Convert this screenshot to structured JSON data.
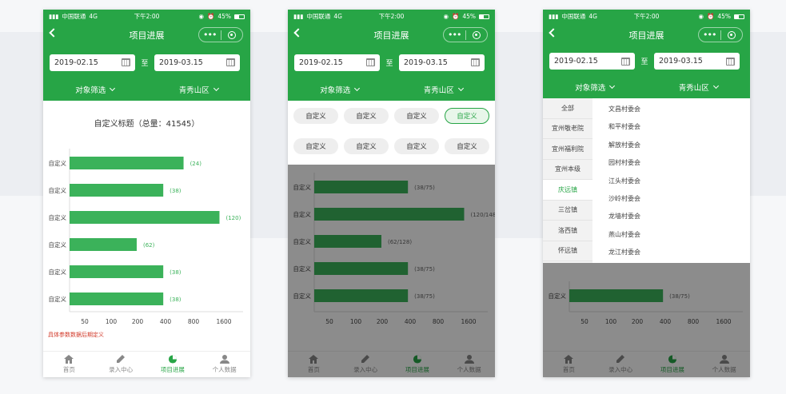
{
  "status": {
    "carrier": "中国联通",
    "network": "4G",
    "time": "下午2:00",
    "battery": "45%"
  },
  "nav": {
    "title": "项目进展",
    "more": "•••"
  },
  "dates": {
    "start": "2019-02.15",
    "sep": "至",
    "end": "2019-03.15"
  },
  "filters": {
    "object": "对象筛选",
    "region": "青秀山区"
  },
  "screen1": {
    "title": "自定义标题（总量：41545）",
    "footnote": "具体参数数据后期定义",
    "chart_data": {
      "type": "bar",
      "orientation": "horizontal",
      "categories": [
        "自定义",
        "自定义",
        "自定义",
        "自定义",
        "自定义",
        "自定义"
      ],
      "values": [
        24,
        38,
        120,
        62,
        38,
        38
      ],
      "value_labels": [
        "(24)",
        "(38)",
        "(120)",
        "(62)",
        "(38)",
        "(38)"
      ],
      "bar_fill": [
        0.73,
        0.6,
        0.96,
        0.43,
        0.6,
        0.6
      ],
      "x_ticks": [
        "50",
        "100",
        "200",
        "400",
        "800",
        "1600"
      ],
      "color": "#3bb25a"
    }
  },
  "screen2": {
    "chips": [
      "自定义",
      "自定义",
      "自定义",
      "自定义",
      "自定义",
      "自定义",
      "自定义",
      "自定义"
    ],
    "selected_chip": 3,
    "chart_data": {
      "type": "bar",
      "orientation": "horizontal",
      "categories": [
        "自定义",
        "自定义",
        "自定义",
        "自定义",
        "自定义"
      ],
      "value_labels": [
        "(38/75)",
        "(120/148)",
        "(62/128)",
        "(38/75)",
        "(38/75)"
      ],
      "bar_fill": [
        0.6,
        0.96,
        0.43,
        0.6,
        0.6
      ],
      "x_ticks": [
        "50",
        "100",
        "200",
        "400",
        "800",
        "1600"
      ]
    }
  },
  "screen3": {
    "left_items": [
      "全部",
      "宜州敬老院",
      "宜州福利院",
      "宜州本级",
      "庆远镇",
      "三岔镇",
      "洛西镇",
      "怀远镇"
    ],
    "selected_left": 4,
    "right_items": [
      "文昌村委会",
      "和平村委会",
      "解放村委会",
      "园村村委会",
      "江头村委会",
      "沙岭村委会",
      "龙墙村委会",
      "燕山村委会",
      "龙江村委会"
    ],
    "chart_data": {
      "type": "bar",
      "orientation": "horizontal",
      "categories": [
        "自定义"
      ],
      "value_labels": [
        "(38/75)"
      ],
      "bar_fill": [
        0.6
      ],
      "x_ticks": [
        "50",
        "100",
        "200",
        "400",
        "800",
        "1600"
      ]
    }
  },
  "tabs": [
    {
      "label": "首页",
      "icon": "home-icon"
    },
    {
      "label": "录入中心",
      "icon": "pen-icon"
    },
    {
      "label": "项目进展",
      "icon": "pie-chart-icon"
    },
    {
      "label": "个人数据",
      "icon": "person-icon"
    }
  ],
  "active_tab": 2,
  "colors": {
    "primary": "#27a546",
    "bar": "#3bb25a",
    "note": "#d23a2a"
  }
}
